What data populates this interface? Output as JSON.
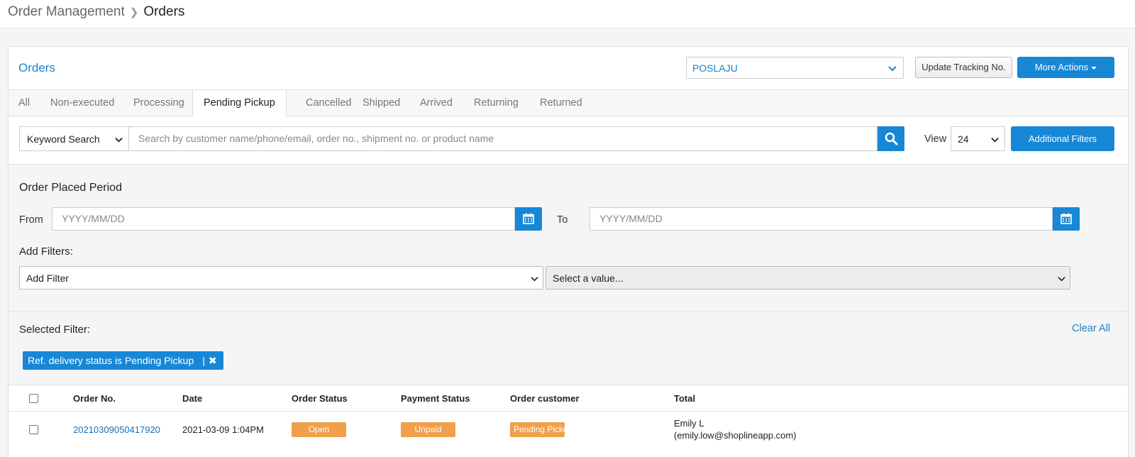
{
  "breadcrumb": {
    "parent": "Order Management",
    "current": "Orders"
  },
  "header": {
    "title": "Orders",
    "carrier_select": "POSLAJU",
    "update_tracking_label": "Update Tracking No.",
    "more_actions_label": "More Actions"
  },
  "tabs": [
    {
      "label": "All"
    },
    {
      "label": "Non-executed"
    },
    {
      "label": "Processing"
    },
    {
      "label": "Pending Pickup",
      "active": true
    },
    {
      "label": "Cancelled"
    },
    {
      "label": "Shipped"
    },
    {
      "label": "Arrived"
    },
    {
      "label": "Returning"
    },
    {
      "label": "Returned"
    }
  ],
  "search": {
    "type_label": "Keyword Search",
    "placeholder": "Search by customer name/phone/email, order no., shipment no. or product name",
    "view_label": "View",
    "view_value": "24",
    "additional_filters_label": "Additional Filters"
  },
  "period": {
    "title": "Order Placed Period",
    "from_label": "From",
    "to_label": "To",
    "from_placeholder": "YYYY/MM/DD",
    "to_placeholder": "YYYY/MM/DD"
  },
  "add_filters": {
    "title": "Add Filters:",
    "filter_select": "Add Filter",
    "value_select": "Select a value..."
  },
  "selected_filter": {
    "title": "Selected Filter:",
    "clear_all_label": "Clear All",
    "chip_label": "Ref. delivery status is Pending Pickup",
    "chip_divider": "|",
    "chip_remove": "✖"
  },
  "table": {
    "headers": [
      "Order No.",
      "Date",
      "Order Status",
      "Payment Status",
      "Order customer",
      "Total"
    ],
    "rows": [
      {
        "order_no": "20210309050417920",
        "date": "2021-03-09 1:04PM",
        "order_status": "Open",
        "payment_status": "Unpaid",
        "delivery_status": "Pending Pickup",
        "customer_name": "Emily L",
        "customer_email": "(emily.low@shoplineapp.com)"
      }
    ]
  },
  "colors": {
    "primary": "#1787d6",
    "link": "#1b82c6",
    "badge": "#f0a04b"
  }
}
